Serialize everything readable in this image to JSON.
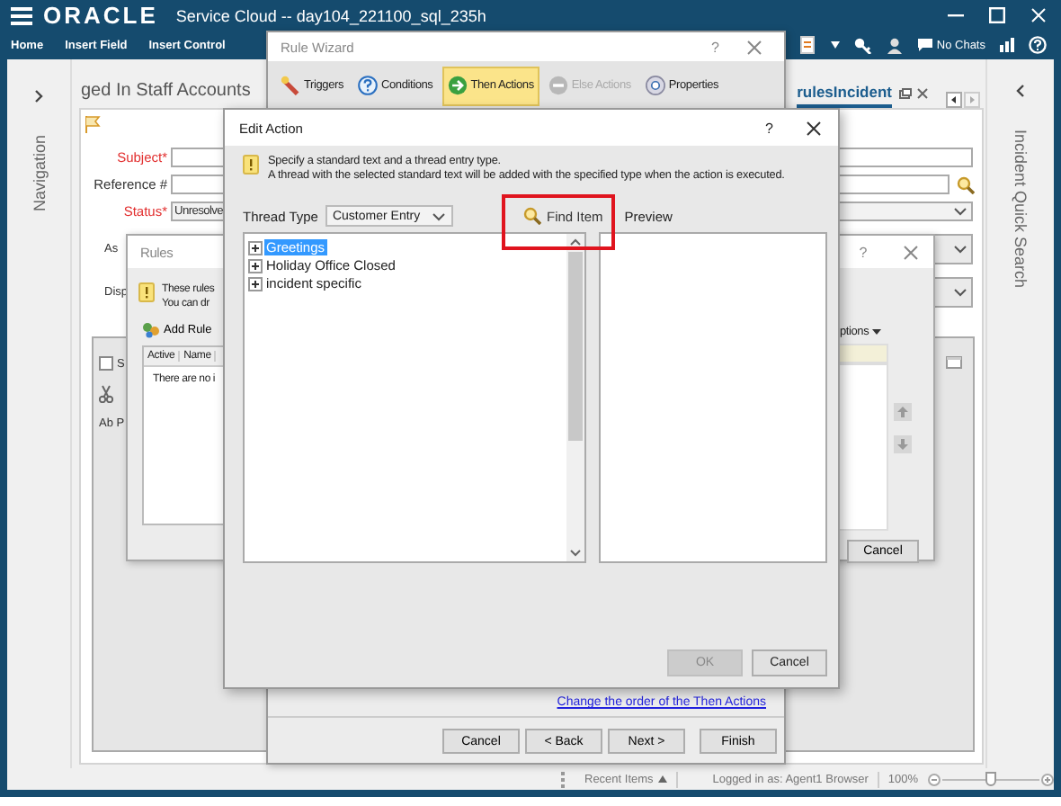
{
  "app": {
    "logo": "ORACLE",
    "title": "Service Cloud -- day104_221100_sql_235h",
    "menu": [
      "Home",
      "Insert Field",
      "Insert Control"
    ],
    "chat_status": "No Chats",
    "left_panel": "Navigation",
    "right_panel": "Incident Quick Search"
  },
  "tabs": [
    {
      "label": "ged In Staff Accounts",
      "selected": false
    },
    {
      "label": "rulesIncident",
      "selected": true
    }
  ],
  "form": {
    "fields": [
      {
        "label": "Subject*",
        "required": true,
        "kind": "text"
      },
      {
        "label": "Reference #",
        "required": false,
        "kind": "search"
      },
      {
        "label": "Status*",
        "required": true,
        "kind": "select",
        "value": "Unresolve"
      },
      {
        "label": "As",
        "required": false,
        "kind": "select"
      },
      {
        "label": "Disp",
        "required": false,
        "kind": "select"
      }
    ],
    "checkbox": {
      "label": "S",
      "checked": false
    },
    "format_label": "Ab P"
  },
  "rules_dialog": {
    "title": "Rules",
    "help": "?",
    "info": [
      "These rules",
      "You can dr"
    ],
    "add_rule": "Add Rule",
    "columns": [
      "Active",
      "Name"
    ],
    "empty_text": "There are no i",
    "options": "ptions",
    "cancel": "Cancel"
  },
  "rule_wizard": {
    "title": "Rule Wizard",
    "help": "?",
    "steps": [
      {
        "label": "Triggers",
        "selected": false,
        "disabled": false
      },
      {
        "label": "Conditions",
        "selected": false,
        "disabled": false
      },
      {
        "label": "Then Actions",
        "selected": true,
        "disabled": false
      },
      {
        "label": "Else Actions",
        "selected": false,
        "disabled": true
      },
      {
        "label": "Properties",
        "selected": false,
        "disabled": false
      }
    ],
    "link": "Change the order of the Then Actions",
    "buttons": [
      "Cancel",
      "< Back",
      "Next >",
      "Finish"
    ]
  },
  "edit_action": {
    "title": "Edit Action",
    "help": "?",
    "info": [
      "Specify a standard text and a thread entry type.",
      "A thread with the selected standard text will be added with the specified type when the action is executed."
    ],
    "thread_type": {
      "label": "Thread Type",
      "value": "Customer Entry"
    },
    "find_item": {
      "label": "Find Item",
      "highlighted": true
    },
    "preview_label": "Preview",
    "tree": [
      {
        "label": "Greetings",
        "selected": true
      },
      {
        "label": "Holiday Office Closed",
        "selected": false
      },
      {
        "label": "incident specific",
        "selected": false
      }
    ],
    "buttons": [
      {
        "label": "OK",
        "disabled": true
      },
      {
        "label": "Cancel",
        "disabled": false
      }
    ]
  },
  "status_bar": {
    "recent_items": "Recent Items",
    "logged_in": "Logged in as: Agent1 Browser",
    "zoom": "100%",
    "zoom_slider": {
      "level": 0.5
    }
  }
}
